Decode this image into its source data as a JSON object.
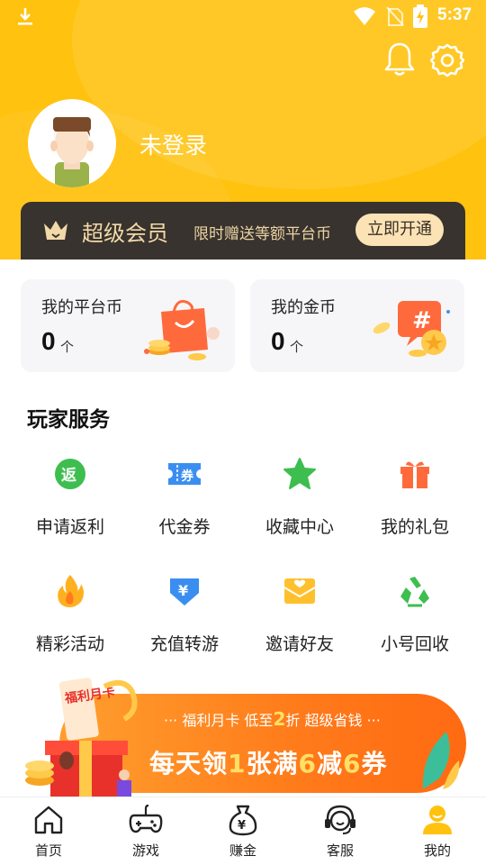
{
  "status_bar": {
    "time": "5:37"
  },
  "profile": {
    "login_status": "未登录"
  },
  "vip": {
    "title": "超级会员",
    "promo": "限时赠送等额平台币",
    "button": "立即开通"
  },
  "wallet": [
    {
      "title": "我的平台币",
      "value": "0",
      "unit": "个"
    },
    {
      "title": "我的金币",
      "value": "0",
      "unit": "个"
    }
  ],
  "services": {
    "title": "玩家服务",
    "items": [
      {
        "label": "申请返利",
        "icon": "rebate-icon"
      },
      {
        "label": "代金券",
        "icon": "coupon-icon"
      },
      {
        "label": "收藏中心",
        "icon": "star-icon"
      },
      {
        "label": "我的礼包",
        "icon": "gift-icon"
      },
      {
        "label": "精彩活动",
        "icon": "fire-icon"
      },
      {
        "label": "充值转游",
        "icon": "yen-down-icon"
      },
      {
        "label": "邀请好友",
        "icon": "invite-envelope-icon"
      },
      {
        "label": "小号回收",
        "icon": "recycle-icon"
      }
    ]
  },
  "banner": {
    "sub_prefix": "··· 福利月卡  低至",
    "sub_num": "2",
    "sub_suffix": "折  超级省钱 ···",
    "main_a": "每天领",
    "main_b": "1",
    "main_c": "张满",
    "main_d": "6",
    "main_e": "减",
    "main_f": "6",
    "main_g": "券",
    "gift_text": "福利月卡"
  },
  "bottom_nav": [
    {
      "label": "首页",
      "icon": "home-icon"
    },
    {
      "label": "游戏",
      "icon": "gamepad-icon"
    },
    {
      "label": "赚金",
      "icon": "money-bag-icon"
    },
    {
      "label": "客服",
      "icon": "headset-icon"
    },
    {
      "label": "我的",
      "icon": "user-icon",
      "active": true
    }
  ],
  "colors": {
    "accent": "#FFC20E",
    "vip_bg": "#38332e",
    "vip_gold": "#F2D9A8",
    "banner": "#FF7A1A"
  }
}
